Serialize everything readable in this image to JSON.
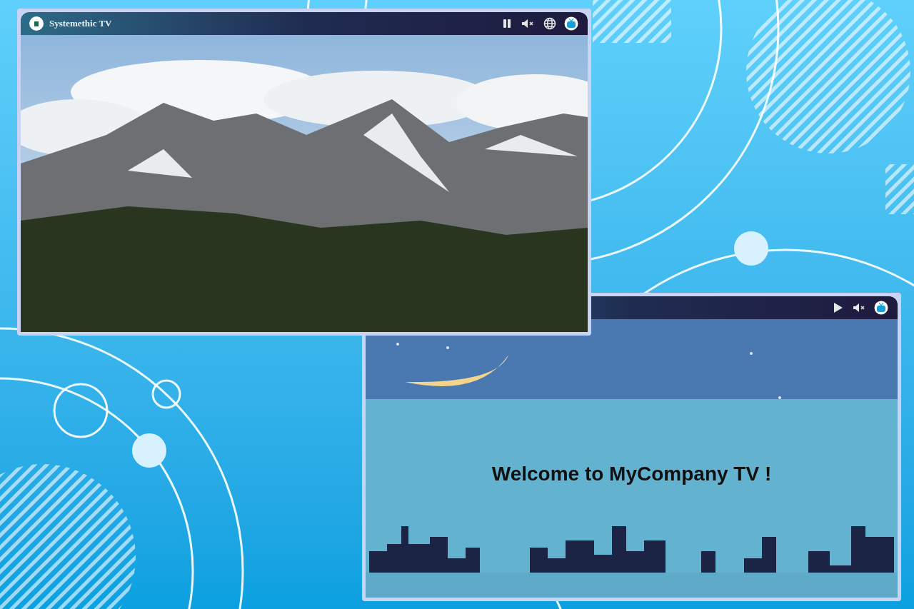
{
  "players": [
    {
      "title": "Systemethic TV",
      "playing": true,
      "muted": true,
      "language_menu": true,
      "content": {
        "kind": "photo"
      }
    },
    {
      "playing": false,
      "muted": true,
      "language_menu": false,
      "content": {
        "kind": "slide",
        "text": "Welcome to MyCompany TV !"
      }
    }
  ]
}
